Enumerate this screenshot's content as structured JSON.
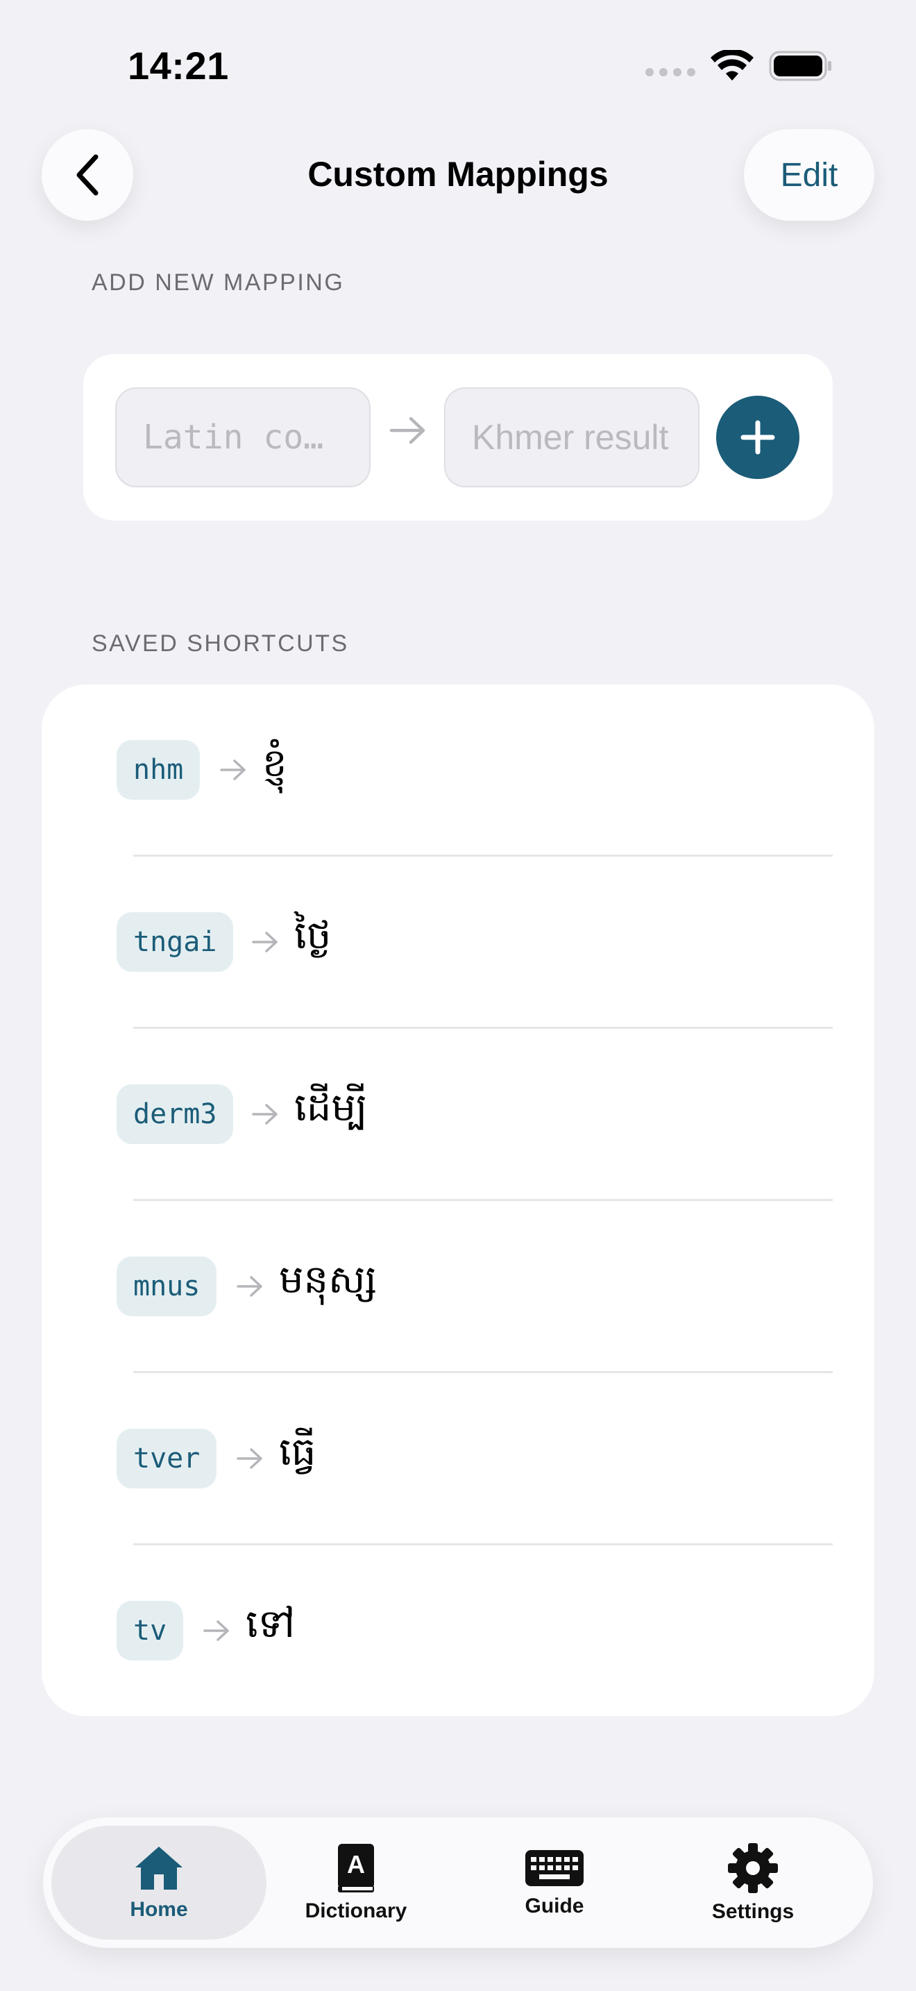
{
  "status_bar": {
    "time": "14:21"
  },
  "nav": {
    "title": "Custom Mappings",
    "edit_label": "Edit"
  },
  "add_section": {
    "label": "ADD NEW MAPPING",
    "latin_placeholder": "Latin co…",
    "khmer_placeholder": "Khmer result"
  },
  "saved_section": {
    "label": "SAVED SHORTCUTS",
    "items": [
      {
        "latin": "nhm",
        "khmer": "ខ្ញុំ"
      },
      {
        "latin": "tngai",
        "khmer": "ថ្ងៃ"
      },
      {
        "latin": "derm3",
        "khmer": "ដើម្បី"
      },
      {
        "latin": "mnus",
        "khmer": "មនុស្ស"
      },
      {
        "latin": "tver",
        "khmer": "ធ្វើ"
      },
      {
        "latin": "tv",
        "khmer": "ទៅ"
      }
    ]
  },
  "tabs": [
    {
      "label": "Home",
      "icon": "house-icon",
      "active": true
    },
    {
      "label": "Dictionary",
      "icon": "dictionary-book-icon",
      "active": false
    },
    {
      "label": "Guide",
      "icon": "keyboard-icon",
      "active": false
    },
    {
      "label": "Settings",
      "icon": "gear-icon",
      "active": false
    }
  ],
  "colors": {
    "accent": "#1b5c78",
    "background": "#f1f1f6",
    "pill": "#e4eef1"
  }
}
